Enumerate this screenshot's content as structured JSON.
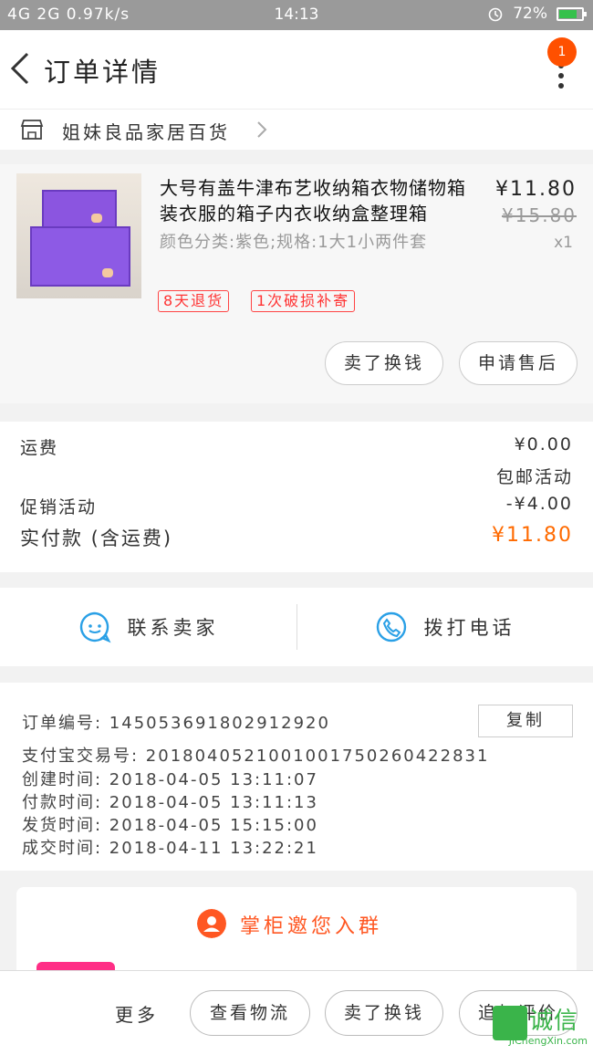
{
  "status_bar": {
    "signal": "4G 2G",
    "speed": "0.97k/s",
    "time": "14:13",
    "battery": "72%"
  },
  "header": {
    "title": "订单详情",
    "badge": "1"
  },
  "shop": {
    "name": "姐妹良品家居百货"
  },
  "product": {
    "title": "大号有盖牛津布艺收纳箱衣物储物箱装衣服的箱子内衣收纳盒整理箱",
    "spec": "颜色分类:紫色;规格:1大1小两件套",
    "price": "¥11.80",
    "original_price": "¥15.80",
    "quantity": "x1",
    "tags": [
      "8天退货",
      "1次破损补寄"
    ],
    "buttons": [
      "卖了换钱",
      "申请售后"
    ]
  },
  "cost": {
    "shipping_label": "运费",
    "shipping_value": "¥0.00",
    "shipping_note": "包邮活动",
    "promo_label": "促销活动",
    "promo_value": "-¥4.00",
    "paid_label": "实付款 (含运费)",
    "paid_value": "¥11.80"
  },
  "contact": {
    "seller": "联系卖家",
    "phone": "拨打电话"
  },
  "order_info": {
    "order_no": "订单编号: 1450536918029129​20",
    "alipay_no": "支付宝交易号: 2018040521001001750260422831",
    "created": "创建时间: 2018-04-05 13:11:07",
    "paid": "付款时间: 2018-04-05 13:11:13",
    "shipped": "发货时间: 2018-04-05 15:15:00",
    "completed": "成交时间: 2018-04-11 13:22:21",
    "copy_label": "复制"
  },
  "group": {
    "title": "掌柜邀您入群"
  },
  "bottom_bar": {
    "more": "更多",
    "buttons": [
      "查看物流",
      "卖了换钱",
      "追加评价"
    ]
  },
  "watermark": {
    "cn": "诚信",
    "en": "JiChengXin.com"
  },
  "colors": {
    "accent": "#ff5000",
    "price_orange": "#ff6a00",
    "tag_red": "#ff3333",
    "icon_blue": "#2aa0e6"
  }
}
